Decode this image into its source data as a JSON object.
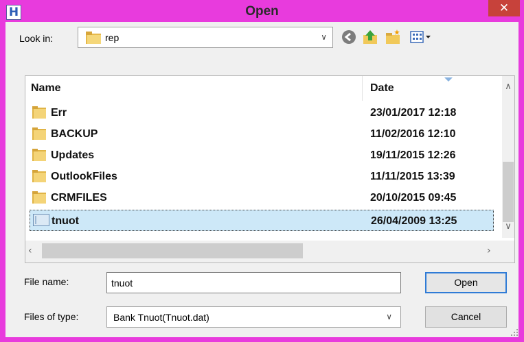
{
  "window": {
    "title": "Open",
    "app_icon_letter": "H",
    "close_glyph": "✕",
    "frame_color": "#e83bdd",
    "close_color": "#c7423b"
  },
  "look_in": {
    "label": "Look in:",
    "value": "rep"
  },
  "toolbar": {
    "icons": [
      "back-icon",
      "up-folder-icon",
      "new-folder-icon",
      "view-menu-icon"
    ]
  },
  "file_list": {
    "columns": [
      "Name",
      "Date"
    ],
    "rows": [
      {
        "name": "Err",
        "date": "23/01/2017 12:18",
        "type": "folder",
        "selected": false
      },
      {
        "name": "BACKUP",
        "date": "11/02/2016 12:10",
        "type": "folder",
        "selected": false
      },
      {
        "name": "Updates",
        "date": "19/11/2015 12:26",
        "type": "folder",
        "selected": false
      },
      {
        "name": "OutlookFiles",
        "date": "11/11/2015 13:39",
        "type": "folder",
        "selected": false
      },
      {
        "name": "CRMFILES",
        "date": "20/10/2015 09:45",
        "type": "folder",
        "selected": false
      },
      {
        "name": "tnuot",
        "date": "26/04/2009 13:25",
        "type": "file",
        "selected": true
      }
    ],
    "selection_color": "#cde8f8"
  },
  "file_name": {
    "label": "File name:",
    "value": "tnuot"
  },
  "file_type": {
    "label": "Files of type:",
    "value": "Bank Tnuot(Tnuot.dat)"
  },
  "buttons": {
    "open": "Open",
    "cancel": "Cancel"
  }
}
